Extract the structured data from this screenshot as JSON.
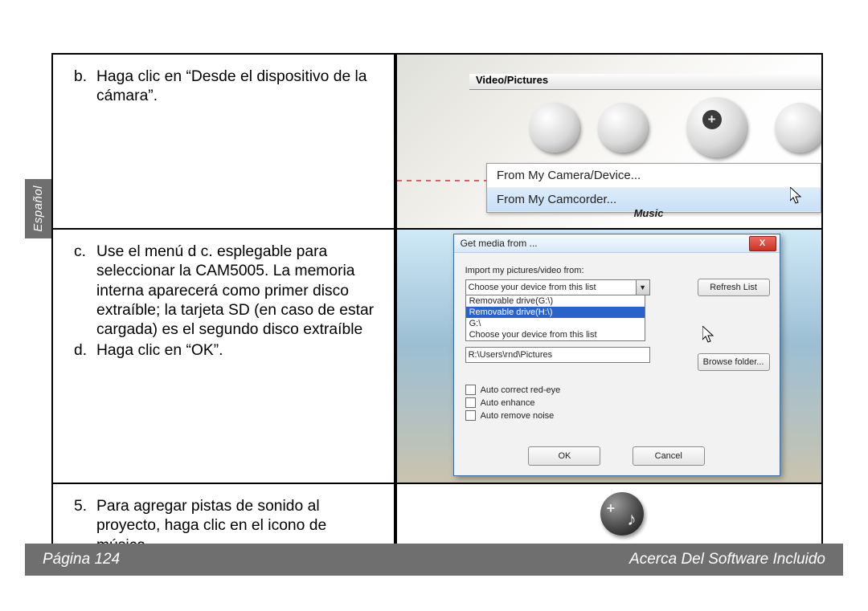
{
  "sideTab": "Español",
  "row1": {
    "bullet": "b.",
    "text": "Haga clic en “Desde el dispositivo de la cámara”.",
    "header": "Video/Pictures",
    "menu1": "From My Camera/Device...",
    "menu2": "From My Camcorder...",
    "music": "Music"
  },
  "row2": {
    "c_bullet": "c.",
    "c_text": "Use el menú d c. esplegable para seleccionar la CAM5005. La memoria interna aparecerá como primer disco extraíble; la tarjeta SD (en caso de estar cargada) es el segundo disco extraíble",
    "d_bullet": "d.",
    "d_text": "Haga clic en “OK”.",
    "dlg_title": "Get media from ...",
    "import_lbl": "Import my pictures/video from:",
    "combo_default": "Choose your device from this list",
    "opt_g": "Removable drive(G:\\)",
    "opt_h": "Removable drive(H:\\)",
    "opt_gcolon": "G:\\",
    "opt_choose": "Choose your device from this list",
    "pathbox": "R:\\Users\\rnd\\Pictures",
    "refresh": "Refresh List",
    "browse": "Browse folder...",
    "chk1": "Auto correct red-eye",
    "chk2": "Auto enhance",
    "chk3": "Auto remove noise",
    "ok": "OK",
    "cancel": "Cancel"
  },
  "row3": {
    "bullet": "5.",
    "text": "Para agregar pistas de sonido al proyecto, haga clic en el icono de música."
  },
  "footer": {
    "page": "Página 124",
    "section": "Acerca Del Software Incluido"
  }
}
